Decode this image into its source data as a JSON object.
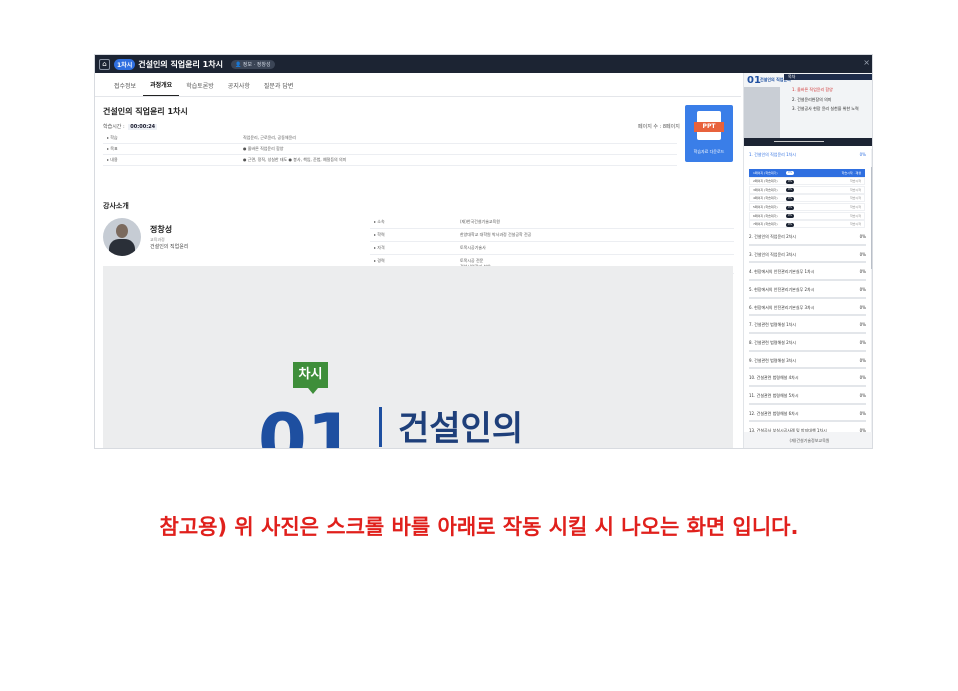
{
  "topbar": {
    "home_icon": "⌂",
    "badge": "1차시",
    "title": "건설인의 직업윤리 1차시",
    "user_badge": "👤 정보 · 정창성",
    "close": "×"
  },
  "tabs": [
    "접수정보",
    "과정개요",
    "학습토론방",
    "공지사항",
    "질문과 답변"
  ],
  "course": {
    "title": "건설인의 직업윤리 1차시",
    "study_time_label": "학습시간 :",
    "study_time": "00:00:24",
    "page_count": "페이지 수 : 8페이지",
    "rows": [
      {
        "label": "▸ 학습",
        "value": "직업윤리, 근로윤리, 공동체윤리"
      },
      {
        "label": "▸ 목표",
        "value": "● 올바른 직업윤리 함양"
      },
      {
        "label": "▸ 내용",
        "value": "● 근면, 정직, 성실한 태도 ● 봉사, 책임, 준법, 예절등의 의미"
      }
    ],
    "ppt_label": "PPT",
    "ppt_caption": "학습자료 다운로드"
  },
  "instructor": {
    "section_title": "강사소개",
    "name": "정창성",
    "dept": "교육과정",
    "course": "건설인의 직업윤리",
    "rows": [
      {
        "label": "▸ 소속",
        "value": "(재)한국건설기술교육원",
        "value2": ""
      },
      {
        "label": "▸ 학력",
        "value": "한양대학교 대학원 박사과정 건설공학 전공",
        "value2": ""
      },
      {
        "label": "▸ 자격",
        "value": "토목시공기술사",
        "value2": ""
      },
      {
        "label": "▸ 경력",
        "value": "토목시공 전문",
        "value2": "건설사업관리 분야"
      }
    ]
  },
  "preview": {
    "chasi": "차시",
    "number": "01",
    "title": "건설인의"
  },
  "side": {
    "video": {
      "num": "01",
      "label": "건설인의 직업윤리",
      "head": "목차",
      "items": [
        "1. 올바른 직업윤리 함양",
        "2. 건설윤리헌장의 의미",
        "3. 건설공사 현장 윤리 실천을 위한 노력"
      ]
    },
    "courses": [
      {
        "name": "1. 건설인의 직업윤리 1차시",
        "pct": "0%"
      },
      {
        "name": "2. 건설인의 직업윤리 2차시",
        "pct": "0%"
      },
      {
        "name": "3. 건설인의 직업윤리 3차시",
        "pct": "0%"
      },
      {
        "name": "4. 현장에서의 안전관리기본실무 1차시",
        "pct": "0%"
      },
      {
        "name": "5. 현장에서의 안전관리기본실무 2차시",
        "pct": "0%"
      },
      {
        "name": "6. 현장에서의 안전관리기본실무 3차시",
        "pct": "0%"
      },
      {
        "name": "7. 건설관련 법령해설 1차시",
        "pct": "0%"
      },
      {
        "name": "8. 건설관련 법령해설 2차시",
        "pct": "0%"
      },
      {
        "name": "9. 건설관련 법령해설 3차시",
        "pct": "0%"
      },
      {
        "name": "10. 건설관련 법령해설 4차시",
        "pct": "0%"
      },
      {
        "name": "11. 건설관련 법령해설 5차시",
        "pct": "0%"
      },
      {
        "name": "12. 건설관련 법령해설 6차시",
        "pct": "0%"
      },
      {
        "name": "13. 건설공사 부실시공사례 및 방지대책 1차시",
        "pct": "0%"
      }
    ],
    "pages": [
      {
        "name": "1페이지 (학습대기)",
        "pct": "0%",
        "status": "학습시작 · 재생"
      },
      {
        "name": "2페이지 (학습대기)",
        "pct": "0%",
        "status": "학습시작"
      },
      {
        "name": "3페이지 (학습대기)",
        "pct": "0%",
        "status": "학습시작"
      },
      {
        "name": "4페이지 (학습대기)",
        "pct": "0%",
        "status": "학습시작"
      },
      {
        "name": "5페이지 (학습대기)",
        "pct": "0%",
        "status": "학습시작"
      },
      {
        "name": "6페이지 (학습대기)",
        "pct": "0%",
        "status": "학습시작"
      },
      {
        "name": "7페이지 (학습대기)",
        "pct": "0%",
        "status": "학습시작"
      }
    ],
    "footer": "(재)건설기술정보교육원"
  },
  "note": "참고용) 위 사진은 스크롤 바를 아래로 작동 시킬 시 나오는 화면 입니다."
}
